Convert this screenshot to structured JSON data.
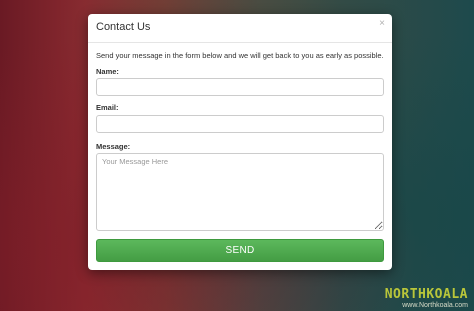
{
  "modal": {
    "title": "Contact Us",
    "close_label": "×",
    "intro": "Send your message in the form below and we will get back to you as early as possible."
  },
  "form": {
    "name_label": "Name:",
    "name_value": "",
    "email_label": "Email:",
    "email_value": "",
    "message_label": "Message:",
    "message_placeholder": "Your Message Here",
    "send_label": "SEND"
  },
  "watermark": {
    "logo": "NORTHKOALA",
    "url": "www.Northkoala.com"
  },
  "colors": {
    "send_button": "#5cb85c",
    "watermark_logo": "#b9c63a"
  }
}
